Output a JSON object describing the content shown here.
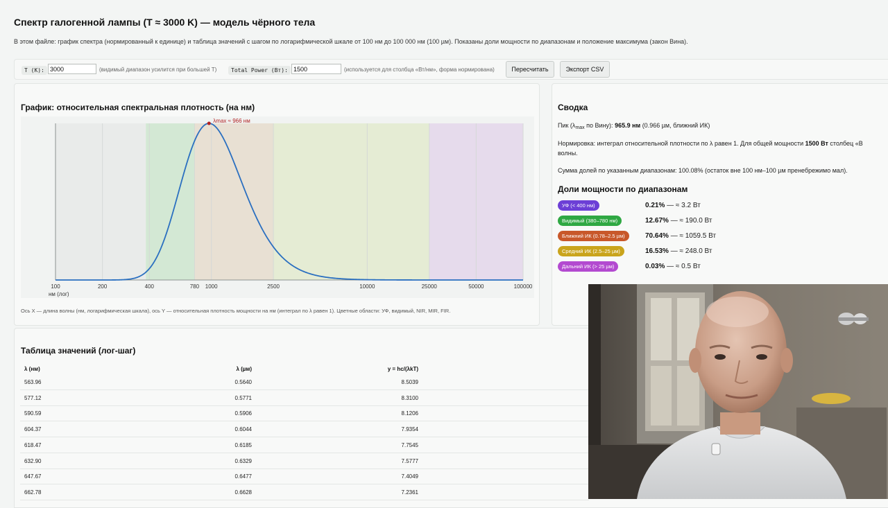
{
  "title": "Спектр галогенной лампы (T ≈ 3000 K) — модель чёрного тела",
  "description": "В этом файле: график спектра (нормированный к единице) и таблица значений с шагом по логарифмической шкале от 100 нм до 100 000 нм (100 µм). Показаны доли мощности по диапазонам и положение максимума (закон Вина).",
  "controls": {
    "t_label": "T (K):",
    "t_value": "3000",
    "t_hint": "(видимый диапазон усилится при большей T)",
    "power_label": "Total Power (Вт):",
    "power_value": "1500",
    "power_hint": "(используется для столбца «Вт/нм», форма нормирована)",
    "recalc_button": "Пересчитать",
    "export_button": "Экспорт CSV"
  },
  "chart_card": {
    "title": "График: относительная спектральная плотность (на нм)",
    "caption": "Ось X — длина волны (нм, логарифмическая шкала), ось Y — относительная плотность мощности на нм (интеграл по λ равен 1). Цветные области: УФ, видимый, NIR, MIR, FIR."
  },
  "chart_data": {
    "type": "line",
    "x_scale": "log",
    "xlim": [
      100,
      100000
    ],
    "x_tick_labels": [
      "100",
      "200",
      "400",
      "780",
      "1000",
      "2500",
      "10000",
      "25000",
      "50000",
      "100000"
    ],
    "x_ticks": [
      100,
      200,
      400,
      780,
      1000,
      2500,
      10000,
      25000,
      50000,
      100000
    ],
    "xlabel": "нм (лог)",
    "peak_annotation": "λmax ≈ 966 нм",
    "peak_x": 966,
    "temperature_K": 3000,
    "bands": [
      {
        "name": "UV",
        "from": 100,
        "to": 380,
        "color": "#e9ebea"
      },
      {
        "name": "VIS",
        "from": 380,
        "to": 780,
        "color": "#d3e8d4"
      },
      {
        "name": "NIR",
        "from": 780,
        "to": 2500,
        "color": "#e8e0d3"
      },
      {
        "name": "MIR",
        "from": 2500,
        "to": 25000,
        "color": "#e5ecd4"
      },
      {
        "name": "FIR",
        "from": 25000,
        "to": 100000,
        "color": "#e6dbec"
      }
    ],
    "line_color": "#2a6fc0",
    "grid": true
  },
  "summary": {
    "title": "Сводка",
    "peak_prefix": "Пик (λ",
    "peak_sub": "max",
    "peak_mid": " по Вину): ",
    "peak_value": "965.9 нм",
    "peak_suffix": " (0.966 µм, ближний ИК)",
    "norm_prefix": "Нормировка: интеграл относительной плотности по λ равен 1. Для общей мощности ",
    "norm_power": "1500 Вт",
    "norm_suffix": " столбец «В",
    "norm_line2": "волны.",
    "sum_text": "Сумма долей по указанным диапазонам: 100.08% (остаток вне 100 нм–100 µм пренебрежимо мал).",
    "bands_title": "Доли мощности по диапазонам",
    "bands": [
      {
        "label": "УФ (< 400 нм)",
        "percent": "0.21%",
        "watts": " — ≈ 3.2 Вт",
        "color": "#6c3fd6"
      },
      {
        "label": "Видимый (380–780 нм)",
        "percent": "12.67%",
        "watts": " — ≈ 190.0 Вт",
        "color": "#2fa843"
      },
      {
        "label": "Ближний ИК (0.78–2.5 µм)",
        "percent": "70.64%",
        "watts": " — ≈ 1059.5 Вт",
        "color": "#c8582a"
      },
      {
        "label": "Средний ИК (2.5–25 µм)",
        "percent": "16.53%",
        "watts": " — ≈ 248.0 Вт",
        "color": "#c9a41c"
      },
      {
        "label": "Дальний ИК (> 25 µм)",
        "percent": "0.03%",
        "watts": " — ≈ 0.5 Вт",
        "color": "#b34ad0"
      }
    ]
  },
  "table": {
    "title": "Таблица значений (лог-шаг)",
    "headers": [
      "λ (нм)",
      "λ (µм)",
      "y = hc/(λkT)"
    ],
    "rows": [
      [
        "563.96",
        "0.5640",
        "8.5039"
      ],
      [
        "577.12",
        "0.5771",
        "8.3100"
      ],
      [
        "590.59",
        "0.5906",
        "8.1206"
      ],
      [
        "604.37",
        "0.6044",
        "7.9354"
      ],
      [
        "618.47",
        "0.6185",
        "7.7545"
      ],
      [
        "632.90",
        "0.6329",
        "7.5777"
      ],
      [
        "647.67",
        "0.6477",
        "7.4049"
      ],
      [
        "662.78",
        "0.6628",
        "7.2361"
      ]
    ]
  }
}
